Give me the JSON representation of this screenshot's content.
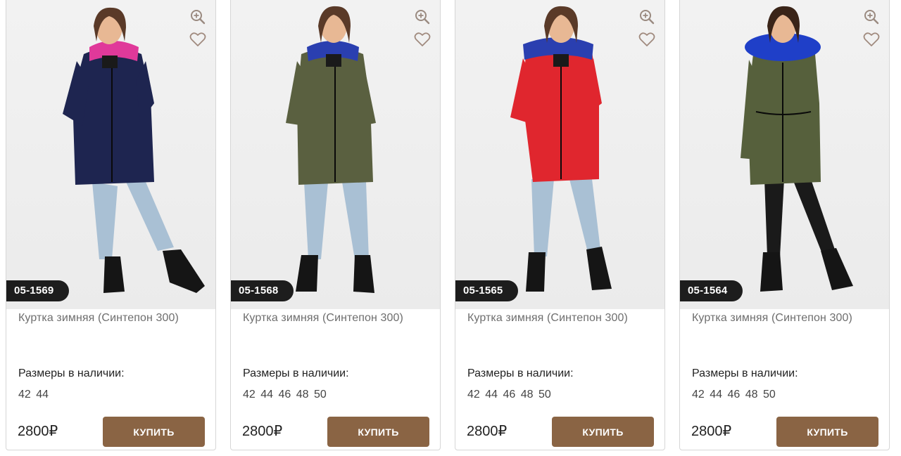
{
  "colors": {
    "accent": "#8a6444",
    "sku_badge": "#1d1d1d",
    "icon": "#9a8a80"
  },
  "products": [
    {
      "sku": "05-1569",
      "title": "Куртка зимняя (Синтепон 300)",
      "sizes_label": "Размеры в наличии:",
      "sizes": "42 44",
      "price": "2800₽",
      "buy_label": "КУПИТЬ",
      "jacket_color": "#1e2550",
      "hood_color": "#e0399a",
      "pants_color": "#a9c0d4",
      "icons": [
        "zoom-in-icon",
        "heart-icon"
      ]
    },
    {
      "sku": "05-1568",
      "title": "Куртка зимняя (Синтепон 300)",
      "sizes_label": "Размеры в наличии:",
      "sizes": "42 44 46 48 50",
      "price": "2800₽",
      "buy_label": "КУПИТЬ",
      "jacket_color": "#5a6040",
      "hood_color": "#2a3fb0",
      "pants_color": "#a9c0d4",
      "icons": [
        "zoom-in-icon",
        "heart-icon"
      ]
    },
    {
      "sku": "05-1565",
      "title": "Куртка зимняя (Синтепон 300)",
      "sizes_label": "Размеры в наличии:",
      "sizes": "42 44 46 48 50",
      "price": "2800₽",
      "buy_label": "КУПИТЬ",
      "jacket_color": "#e0262e",
      "hood_color": "#2a3fb0",
      "pants_color": "#a9c0d4",
      "icons": [
        "zoom-in-icon",
        "heart-icon"
      ]
    },
    {
      "sku": "05-1564",
      "title": "Куртка зимняя (Синтепон 300)",
      "sizes_label": "Размеры в наличии:",
      "sizes": "42 44 46 48 50",
      "price": "2800₽",
      "buy_label": "КУПИТЬ",
      "jacket_color": "#56603c",
      "hood_color": "#1f3fc8",
      "pants_color": "#1a1a1a",
      "icons": [
        "zoom-in-icon",
        "heart-icon"
      ]
    }
  ]
}
